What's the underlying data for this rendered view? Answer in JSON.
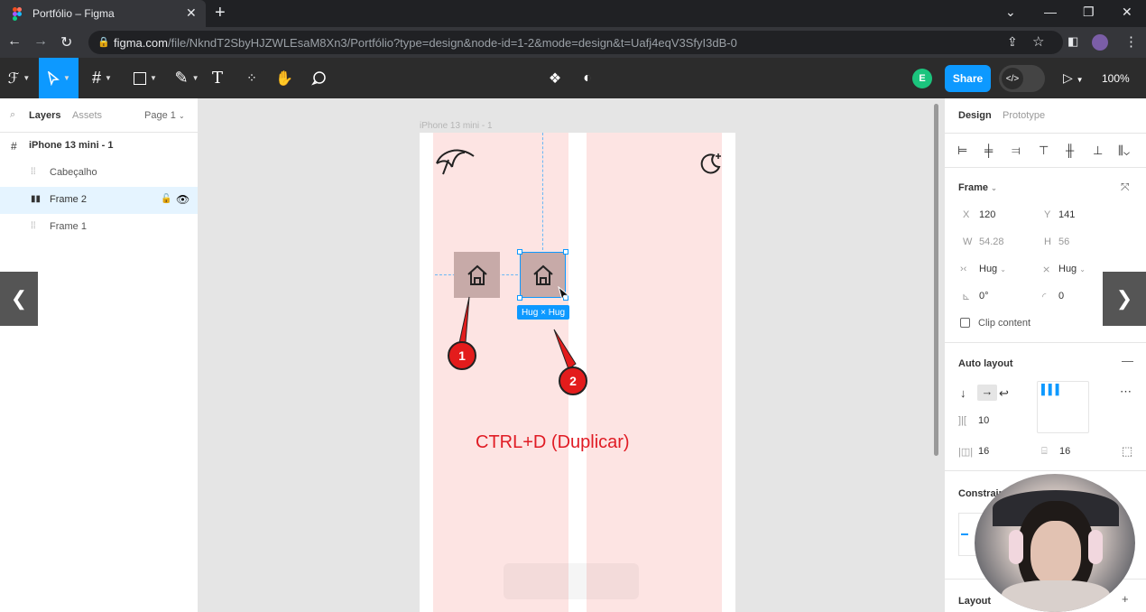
{
  "browser": {
    "tab_title": "Portfólio – Figma",
    "tab_close": "✕",
    "new_tab": "+",
    "url_host": "figma.com",
    "url_path": "/file/NkndT2SbyHJZWLEsaM8Xn3/Portfólio?type=design&node-id=1-2&mode=design&t=Uafj4eqV3SfyI3dB-0"
  },
  "toolbar": {
    "share_label": "Share",
    "zoom_label": "100%",
    "avatar_initial": "E",
    "dev_mode_glyph": "</>"
  },
  "left_panel": {
    "tab_layers": "Layers",
    "tab_assets": "Assets",
    "page_selector": "Page 1",
    "layers": [
      {
        "label": "iPhone 13 mini - 1"
      },
      {
        "label": "Cabeçalho"
      },
      {
        "label": "Frame 2"
      },
      {
        "label": "Frame 1"
      }
    ]
  },
  "canvas": {
    "frame_label": "iPhone 13 mini - 1",
    "hug_badge": "Hug × Hug",
    "caption": "CTRL+D (Duplicar)",
    "marker_1": "1",
    "marker_2": "2"
  },
  "right_panel": {
    "tab_design": "Design",
    "tab_prototype": "Prototype",
    "frame_section": "Frame",
    "x_label": "X",
    "x_value": "120",
    "y_label": "Y",
    "y_value": "141",
    "w_label": "W",
    "w_value": "54.28",
    "h_label": "H",
    "h_value": "56",
    "hug_w": "Hug",
    "hug_h": "Hug",
    "rotation": "0°",
    "radius": "0",
    "clip_content": "Clip content",
    "auto_layout": "Auto layout",
    "gap": "10",
    "padding_h": "16",
    "padding_v": "16",
    "constraints": "Constraint",
    "layout": "Layout"
  },
  "colors": {
    "accent": "#0d99ff",
    "canvas_bg": "#e5e5e5",
    "frame_column": "#fde4e3",
    "home_box": "#c7aaa8",
    "annotation_red": "#e01b24"
  }
}
